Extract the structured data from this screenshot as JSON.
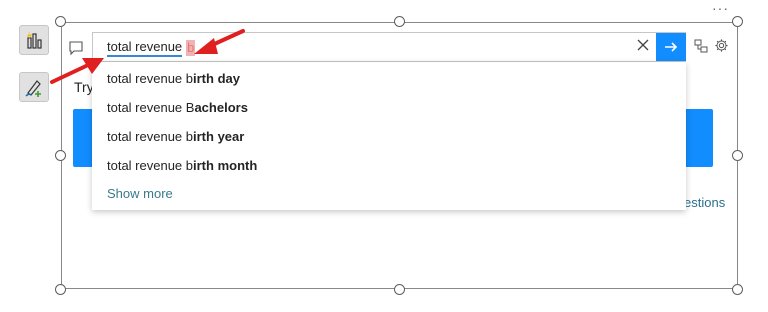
{
  "qa": {
    "typed_text": "total revenue",
    "pending_text": "b"
  },
  "suggestions": [
    {
      "prefix": "total revenue b",
      "completion": "irth day"
    },
    {
      "prefix": "total revenue B",
      "completion": "achelors"
    },
    {
      "prefix": "total revenue b",
      "completion": "irth year"
    },
    {
      "prefix": "total revenue b",
      "completion": "irth month"
    }
  ],
  "show_more_label": "Show more",
  "background": {
    "try_label": "Try",
    "see_suggestions_fragment": "estions"
  },
  "overflow_label": "···",
  "icons": {
    "rail_top": "visual-chart-icon",
    "rail_bottom": "format-brush-icon",
    "comment": "comment-icon",
    "clear": "close-icon",
    "submit": "arrow-right-icon",
    "share": "share-icon",
    "settings": "gear-icon"
  },
  "colors": {
    "accent": "#118dff",
    "annotation_arrow": "#e02020",
    "link": "#3a7a8c",
    "typed_underline": "#3a86d4"
  }
}
